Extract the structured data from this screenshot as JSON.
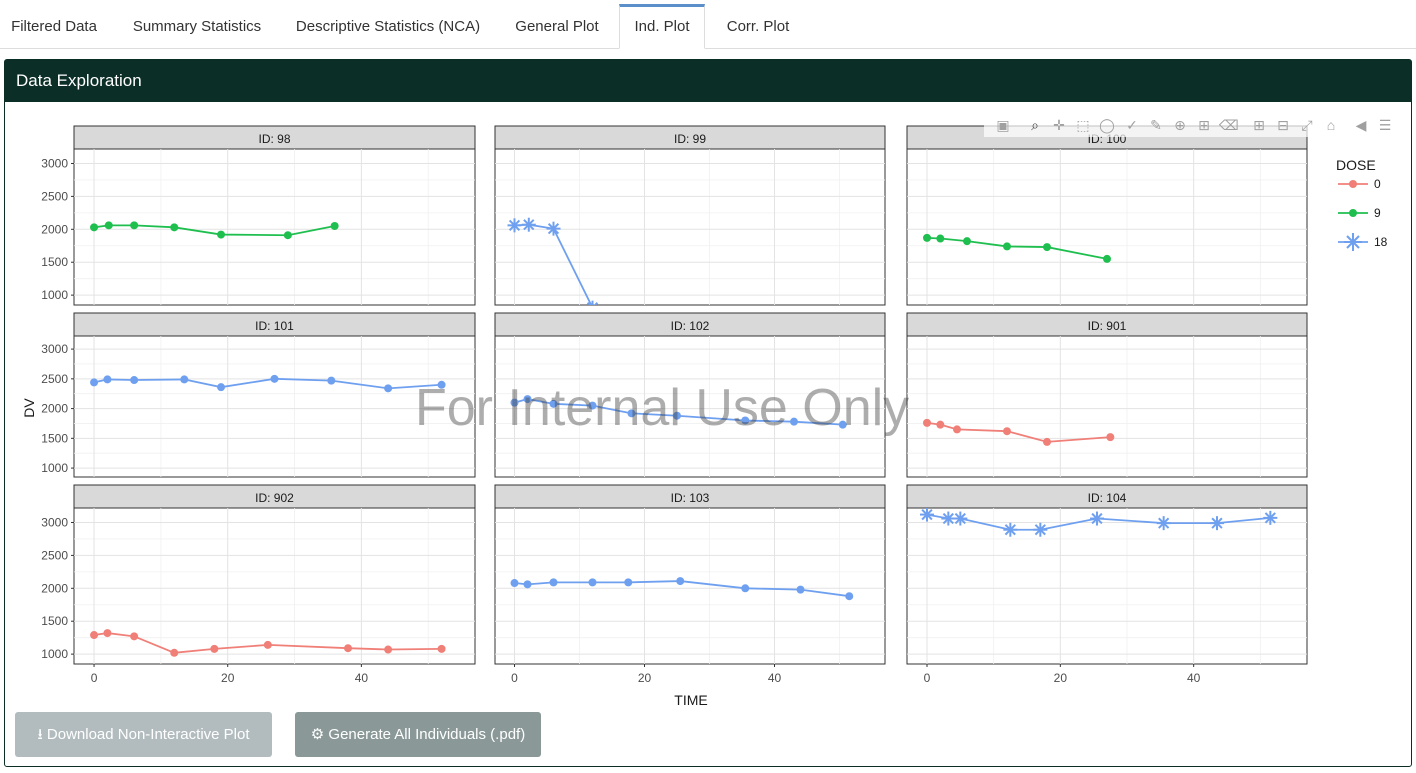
{
  "tabs": [
    {
      "label": "Filtered Data",
      "active": false
    },
    {
      "label": "Summary Statistics",
      "active": false
    },
    {
      "label": "Descriptive Statistics (NCA)",
      "active": false
    },
    {
      "label": "General Plot",
      "active": false
    },
    {
      "label": "Ind. Plot",
      "active": true
    },
    {
      "label": "Corr. Plot",
      "active": false
    }
  ],
  "panel": {
    "title": "Data Exploration"
  },
  "modebar_icons": [
    "camera-icon",
    "zoom-icon",
    "pan-icon",
    "box-select-icon",
    "lasso-select-icon",
    "draw-open-path-icon",
    "draw-line-icon",
    "draw-circle-icon",
    "draw-rect-icon",
    "erase-shape-icon",
    "zoom-in-icon",
    "zoom-out-icon",
    "autoscale-icon",
    "home-icon",
    "compare-hover-icon",
    "closest-hover-icon"
  ],
  "watermark": "For Internal Use Only",
  "buttons": {
    "download_label": "Download Non-Interactive Plot",
    "generate_label": "Generate All Individuals (.pdf)"
  },
  "colors": {
    "dose0": "#f07f78",
    "dose9": "#1fbf4f",
    "dose18": "#6fa0f0",
    "header": "#0b2f27"
  },
  "chart_data": {
    "type": "line",
    "xlabel": "TIME",
    "ylabel": "DV",
    "x_ticks": [
      0,
      20,
      40
    ],
    "y_ticks": [
      1000,
      1500,
      2000,
      2500,
      3000
    ],
    "xlim": [
      -3,
      57
    ],
    "ylim": [
      850,
      3220
    ],
    "legend": {
      "title": "DOSE",
      "entries": [
        "0",
        "9",
        "18"
      ],
      "placement": "right"
    },
    "facets": [
      {
        "label": "ID: 98",
        "dose": "9",
        "x": [
          0,
          2.2,
          6,
          12,
          19,
          29,
          36
        ],
        "y": [
          2030,
          2060,
          2060,
          2030,
          1920,
          1910,
          2050
        ]
      },
      {
        "label": "ID: 99",
        "dose": "18",
        "x": [
          0,
          2.2,
          6,
          12
        ],
        "y": [
          2060,
          2070,
          2010,
          810
        ]
      },
      {
        "label": "ID: 100",
        "dose": "9",
        "x": [
          0,
          2,
          6,
          12,
          18,
          27
        ],
        "y": [
          1870,
          1860,
          1820,
          1740,
          1730,
          1550
        ]
      },
      {
        "label": "ID: 101",
        "dose": "18",
        "x": [
          0,
          2,
          6,
          13.5,
          19,
          27,
          35.5,
          44,
          52
        ],
        "y": [
          2440,
          2490,
          2480,
          2490,
          2360,
          2500,
          2470,
          2340,
          2400
        ]
      },
      {
        "label": "ID: 102",
        "dose": "18",
        "x": [
          0,
          2,
          6,
          12,
          18,
          25,
          35.5,
          43,
          50.5
        ],
        "y": [
          2100,
          2160,
          2080,
          2050,
          1920,
          1880,
          1800,
          1780,
          1730
        ]
      },
      {
        "label": "ID: 901",
        "dose": "0",
        "x": [
          0,
          2,
          4.5,
          12,
          18,
          27.5
        ],
        "y": [
          1760,
          1730,
          1650,
          1620,
          1440,
          1520
        ]
      },
      {
        "label": "ID: 902",
        "dose": "0",
        "x": [
          0,
          2,
          6,
          12,
          18,
          26,
          38,
          44,
          52
        ],
        "y": [
          1290,
          1320,
          1270,
          1020,
          1080,
          1140,
          1090,
          1070,
          1080
        ]
      },
      {
        "label": "ID: 103",
        "dose": "18",
        "x": [
          0,
          2,
          6,
          12,
          17.5,
          25.5,
          35.5,
          44,
          51.5
        ],
        "y": [
          2080,
          2060,
          2090,
          2090,
          2090,
          2110,
          2000,
          1980,
          1880
        ]
      },
      {
        "label": "ID: 104",
        "dose": "18",
        "x": [
          0,
          3.2,
          5,
          12.5,
          17,
          25.5,
          35.5,
          43.5,
          51.5
        ],
        "y": [
          3120,
          3060,
          3060,
          2890,
          2890,
          3060,
          2990,
          2990,
          3070
        ]
      }
    ]
  }
}
